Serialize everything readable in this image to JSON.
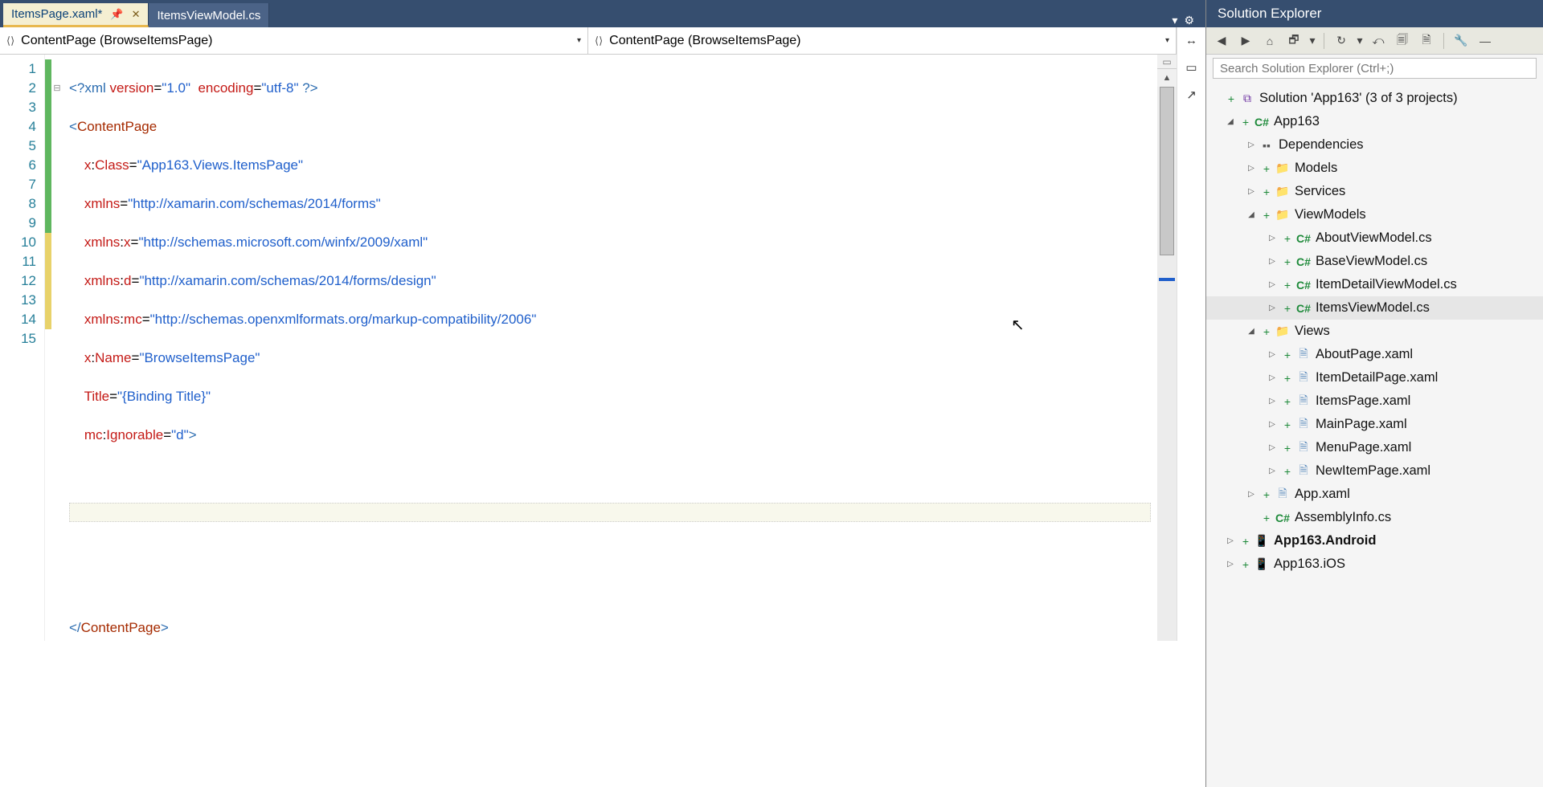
{
  "tabs": {
    "active": {
      "label": "ItemsPage.xaml*",
      "pin": "📌",
      "close": "✕"
    },
    "inactive": {
      "label": "ItemsViewModel.cs"
    }
  },
  "tab_right": {
    "dropdown": "▾",
    "gear": "⚙"
  },
  "nav": {
    "left": {
      "icon": "⟨⟩",
      "label": "ContentPage (BrowseItemsPage)",
      "caret": "▾"
    },
    "right": {
      "icon": "⟨⟩",
      "label": "ContentPage (BrowseItemsPage)",
      "caret": "▾"
    },
    "sidebuttons": {
      "a": "↔",
      "b": "▭",
      "c": "↗"
    }
  },
  "editor": {
    "line_count": 15,
    "lines": {
      "l1a": "<?xml",
      "l1b": " version",
      "l1c": "=",
      "l1d": "\"1.0\"",
      "l1e": "  encoding",
      "l1f": "=",
      "l1g": "\"utf-8\"",
      "l1h": " ?>",
      "l2a": "<",
      "l2b": "ContentPage",
      "l3a": "    x",
      "l3b": ":",
      "l3c": "Class",
      "l3d": "=",
      "l3e": "\"App163.Views.ItemsPage\"",
      "l4a": "    xmlns",
      "l4b": "=",
      "l4c": "\"http://xamarin.com/schemas/2014/forms\"",
      "l5a": "    xmlns",
      "l5b": ":",
      "l5c": "x",
      "l5d": "=",
      "l5e": "\"http://schemas.microsoft.com/winfx/2009/xaml\"",
      "l6a": "    xmlns",
      "l6b": ":",
      "l6c": "d",
      "l6d": "=",
      "l6e": "\"http://xamarin.com/schemas/2014/forms/design\"",
      "l7a": "    xmlns",
      "l7b": ":",
      "l7c": "mc",
      "l7d": "=",
      "l7e": "\"http://schemas.openxmlformats.org/markup-compatibility/2006\"",
      "l8a": "    x",
      "l8b": ":",
      "l8c": "Name",
      "l8d": "=",
      "l8e": "\"BrowseItemsPage\"",
      "l9a": "    Title",
      "l9b": "=",
      "l9c": "\"{Binding Title}\"",
      "l10a": "    mc",
      "l10b": ":",
      "l10c": "Ignorable",
      "l10d": "=",
      "l10e": "\"d\"",
      "l10f": ">",
      "l15a": "</",
      "l15b": "ContentPage",
      "l15c": ">"
    }
  },
  "solution_explorer": {
    "title": "Solution Explorer",
    "search_placeholder": "Search Solution Explorer (Ctrl+;)",
    "toolbar": {
      "back": "◀",
      "fwd": "▶",
      "home": "⌂",
      "switch": "🗗",
      "switch_caret": "▾",
      "refresh": "↻",
      "refresh_caret": "▾",
      "collapse": "⤺",
      "showall": "🗐",
      "props": "🗎",
      "wrench": "🔧",
      "more": "—"
    },
    "root": "Solution 'App163' (3 of 3 projects)",
    "proj1": "App163",
    "deps": "Dependencies",
    "models": "Models",
    "services": "Services",
    "viewmodels": "ViewModels",
    "views": "Views",
    "vm1": "AboutViewModel.cs",
    "vm2": "BaseViewModel.cs",
    "vm3": "ItemDetailViewModel.cs",
    "vm4": "ItemsViewModel.cs",
    "v1": "AboutPage.xaml",
    "v2": "ItemDetailPage.xaml",
    "v3": "ItemsPage.xaml",
    "v4": "MainPage.xaml",
    "v5": "MenuPage.xaml",
    "v6": "NewItemPage.xaml",
    "appxaml": "App.xaml",
    "asm": "AssemblyInfo.cs",
    "proj2": "App163.Android",
    "proj3": "App163.iOS"
  }
}
